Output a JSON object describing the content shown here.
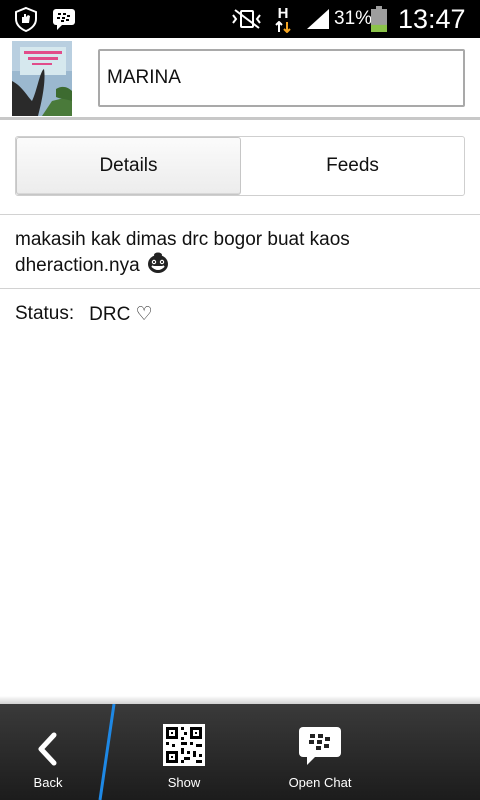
{
  "status_bar": {
    "battery_percent": "31%",
    "time": "13:47",
    "network_type": "H",
    "icons": [
      "shield-hand-icon",
      "bbm-notification-icon",
      "vibrate-icon",
      "network-h-icon",
      "signal-icon",
      "battery-icon"
    ],
    "battery_level": 0.31,
    "battery_color": "#8bc34a"
  },
  "profile": {
    "name": "MARINA",
    "avatar": "profile-photo"
  },
  "tabs": [
    {
      "label": "Details",
      "active": true
    },
    {
      "label": "Feeds",
      "active": false
    }
  ],
  "message": {
    "text": "makasih kak dimas drc bogor buat kaos dheraction.nya",
    "emoticon": "smiley-emoticon-icon"
  },
  "status": {
    "label": "Status:",
    "value": "DRC ♡"
  },
  "bottom_actions": [
    {
      "label": "Back",
      "icon": "back-chevron-icon"
    },
    {
      "label": "Show",
      "icon": "qr-code-icon"
    },
    {
      "label": "Open Chat",
      "icon": "bbm-chat-icon"
    }
  ],
  "colors": {
    "accent_blue": "#1e88e5",
    "action_bar": "#2b2b2b"
  }
}
